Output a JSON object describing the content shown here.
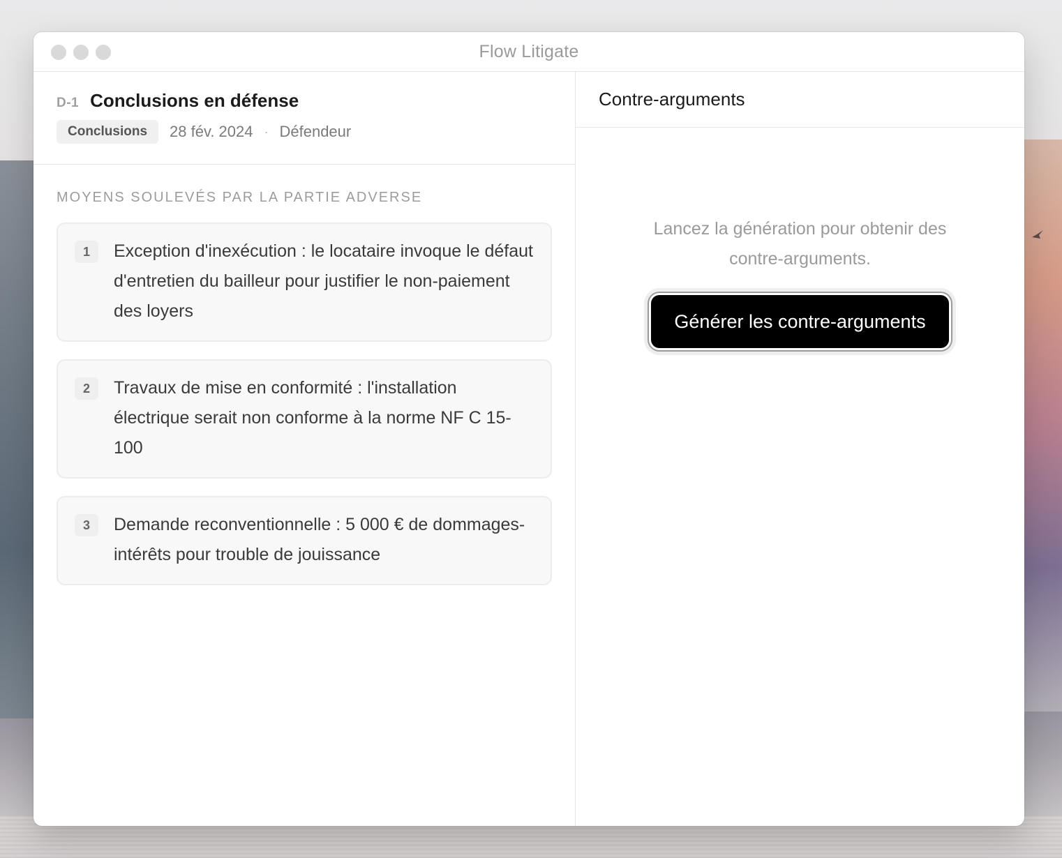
{
  "window": {
    "title": "Flow Litigate"
  },
  "document": {
    "id": "D-1",
    "title": "Conclusions en défense",
    "tag": "Conclusions",
    "date": "28 fév. 2024",
    "separator": "·",
    "party": "Défendeur"
  },
  "arguments_section": {
    "label": "MOYENS SOULEVÉS PAR LA PARTIE ADVERSE",
    "items": [
      {
        "number": "1",
        "text": "Exception d'inexécution : le locataire invoque le défaut d'entretien du bailleur pour justifier le non-paiement des loyers"
      },
      {
        "number": "2",
        "text": "Travaux de mise en conformité : l'installation électrique serait non conforme à la norme NF C 15-100"
      },
      {
        "number": "3",
        "text": "Demande reconventionnelle : 5 000 € de dommages-intérêts pour trouble de jouissance"
      }
    ]
  },
  "counter_panel": {
    "title": "Contre-arguments",
    "empty_text": "Lancez la génération pour obtenir des contre-arguments.",
    "generate_label": "Générer les contre-arguments"
  }
}
